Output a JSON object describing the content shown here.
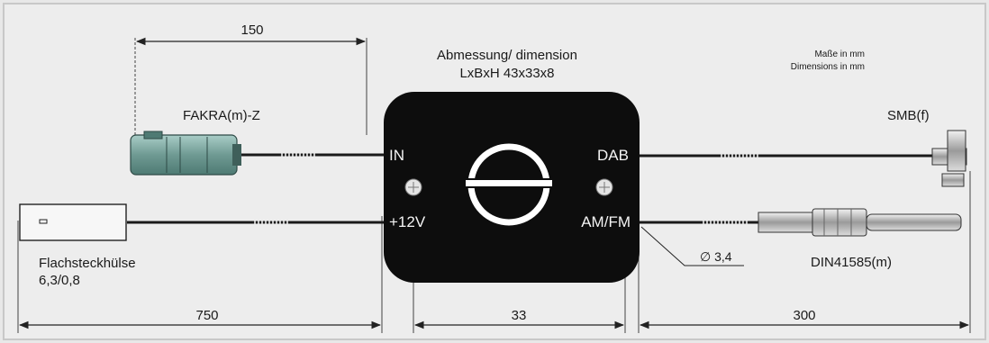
{
  "header": {
    "title_line1": "Abmessung/ dimension",
    "title_line2": "LxBxH 43x33x8",
    "units_de": "Maße in mm",
    "units_en": "Dimensions in mm"
  },
  "dimensions": {
    "top_lead": "150",
    "bottom_left": "750",
    "box_width": "33",
    "bottom_right": "300",
    "cable_diameter": "∅ 3,4"
  },
  "connectors": {
    "fakra": "FAKRA(m)-Z",
    "smb": "SMB(f)",
    "flat_line1": "Flachsteckhülse",
    "flat_line2": "6,3/0,8",
    "din": "DIN41585(m)"
  },
  "ports": {
    "in": "IN",
    "power": "+12V",
    "dab": "DAB",
    "amfm": "AM/FM"
  },
  "colors": {
    "background": "#e8e8e8",
    "box": "#0d0d0d",
    "connector_teal": "#7fa9a2",
    "line": "#222222"
  }
}
